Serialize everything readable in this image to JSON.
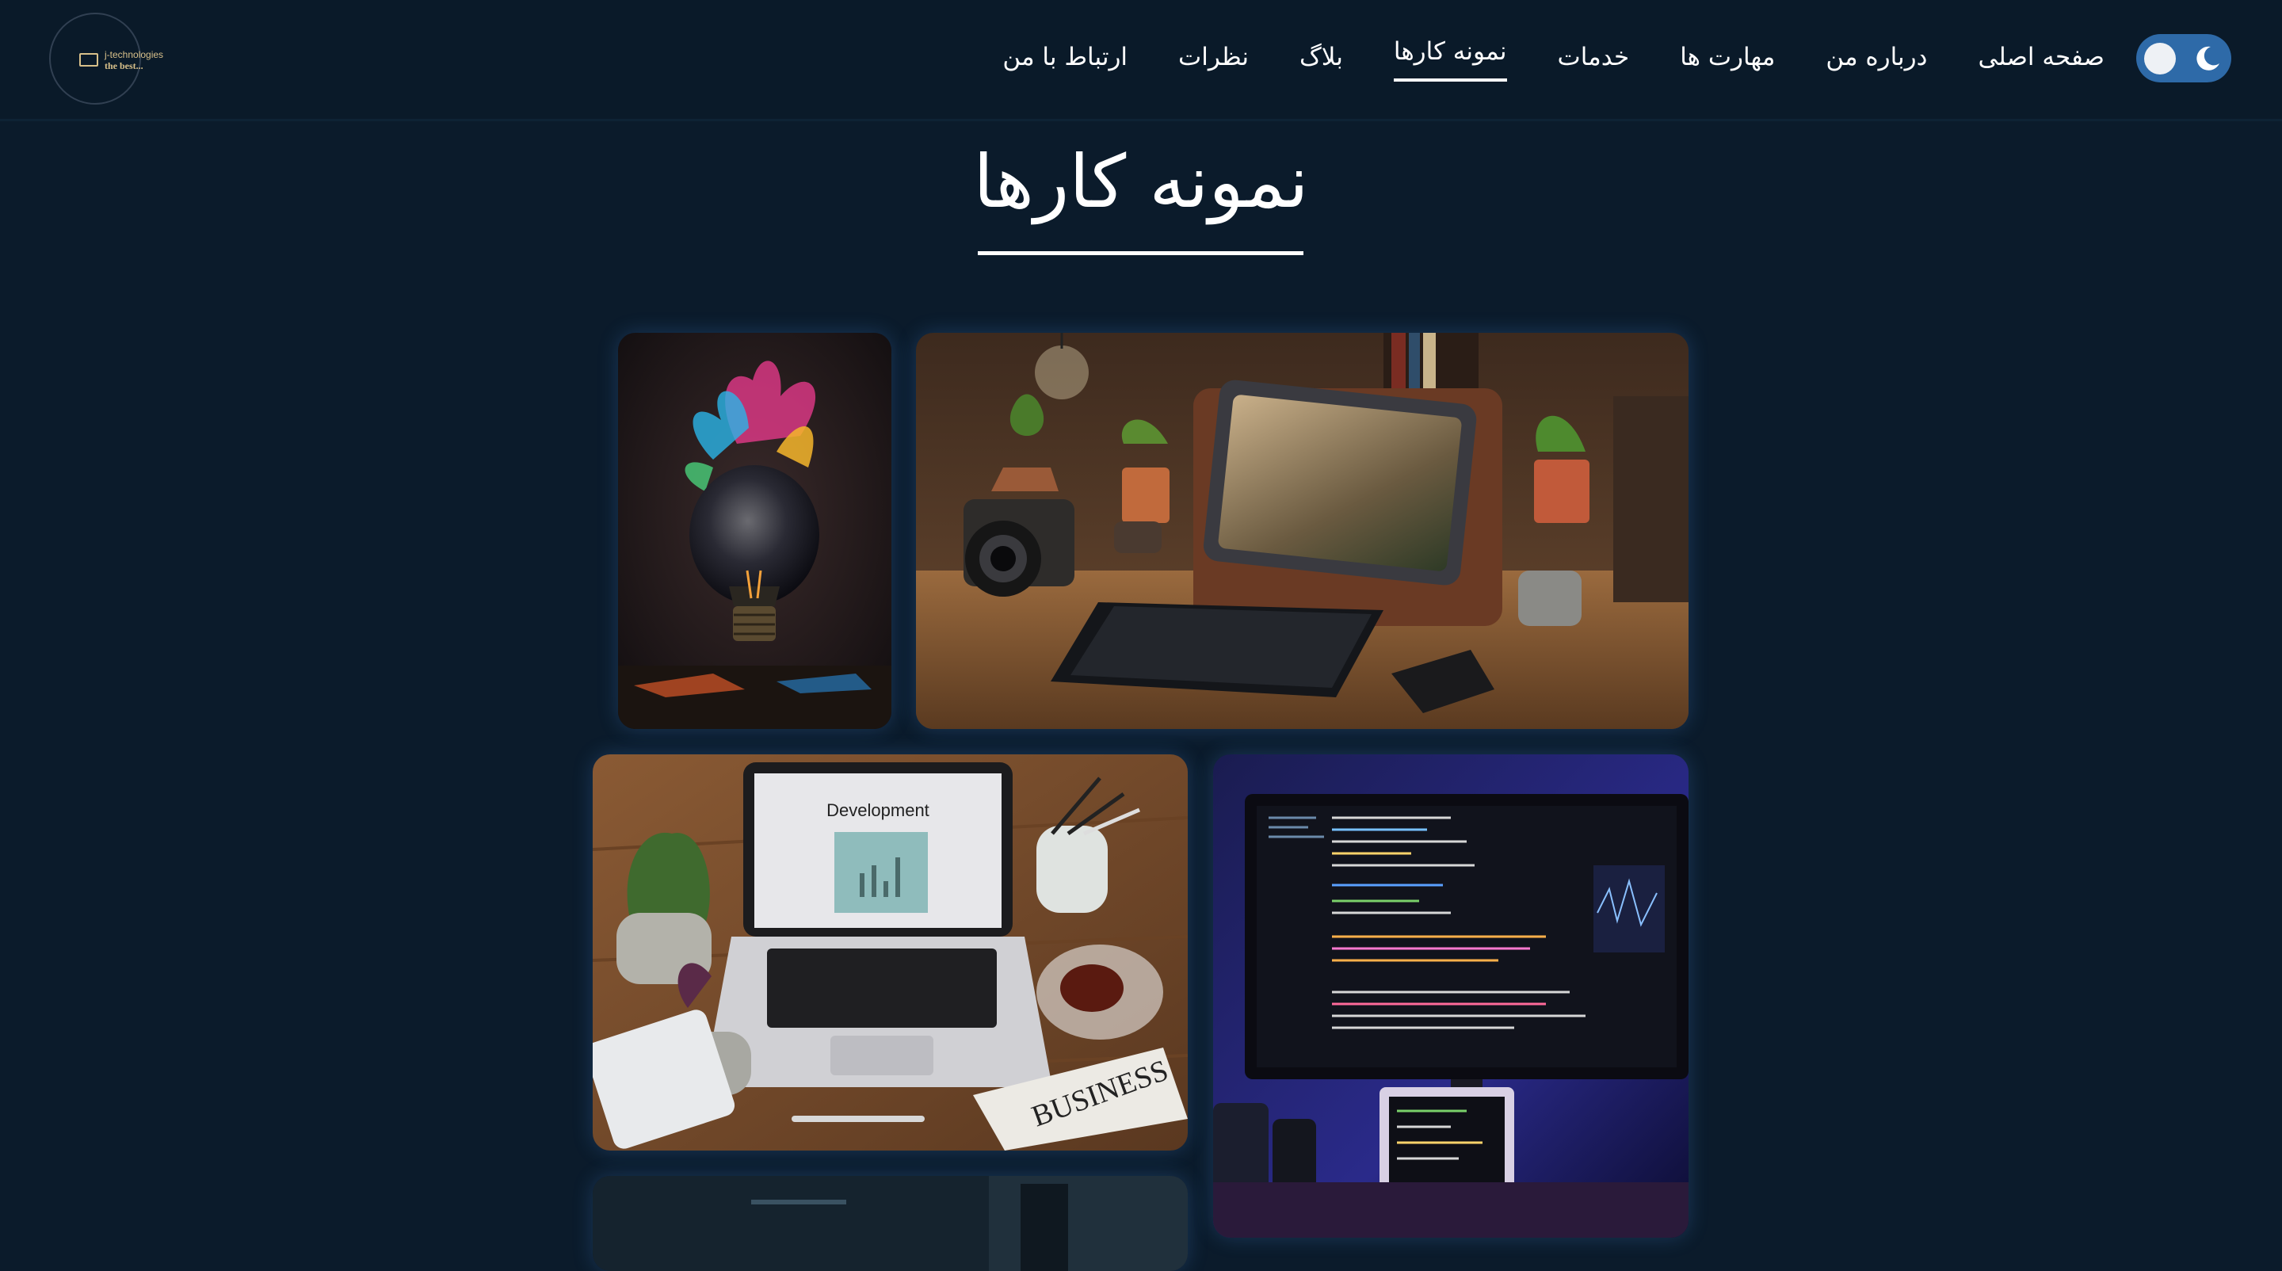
{
  "logo": {
    "line1": "j-technologies",
    "line2": "the best..."
  },
  "nav": {
    "items": [
      {
        "label": "صفحه اصلی",
        "active": false
      },
      {
        "label": "درباره من",
        "active": false
      },
      {
        "label": "مهارت ها",
        "active": false
      },
      {
        "label": "خدمات",
        "active": false
      },
      {
        "label": "نمونه کارها",
        "active": true
      },
      {
        "label": "بلاگ",
        "active": false
      },
      {
        "label": "نظرات",
        "active": false
      },
      {
        "label": "ارتباط با من",
        "active": false
      }
    ]
  },
  "theme_toggle": {
    "mode": "dark",
    "icon": "moon-icon"
  },
  "section": {
    "title": "نمونه کارها"
  },
  "gallery": {
    "items": [
      {
        "name": "lightbulb-paint-image"
      },
      {
        "name": "desk-tablet-camera-image"
      },
      {
        "name": "laptop-development-image",
        "screen_text": "Development",
        "paper_text": "BUSINESS"
      },
      {
        "name": "coding-monitor-image"
      },
      {
        "name": "partial-bottom-image"
      }
    ]
  },
  "colors": {
    "background": "#0b1b2b",
    "header": "#0a1a29",
    "toggle": "#2e6aa8",
    "text": "#ffffff"
  }
}
